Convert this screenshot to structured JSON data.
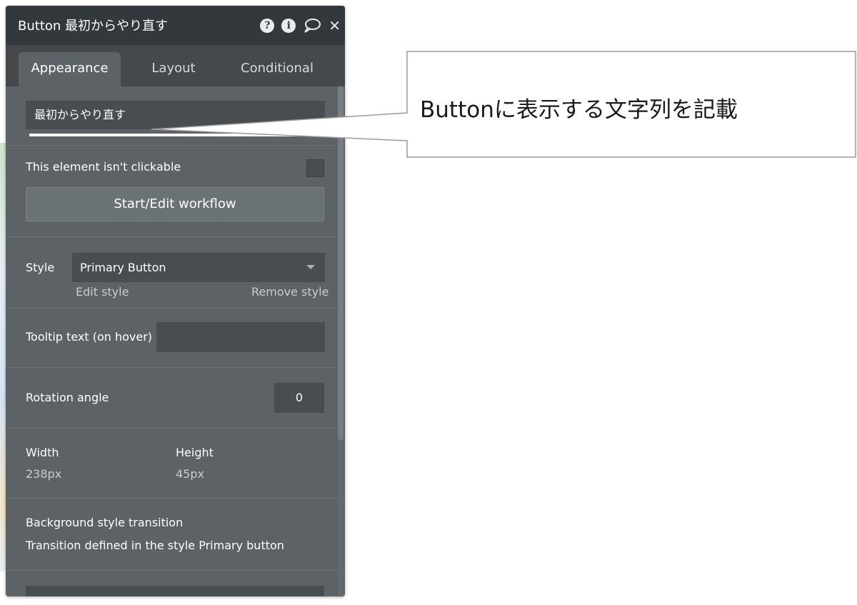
{
  "window": {
    "title": "Button 最初からやり直す",
    "icons": [
      "help-icon",
      "info-icon",
      "comment-icon",
      "close-icon"
    ],
    "icon_glyphs": {
      "help": "?",
      "info": "i",
      "close": "✕"
    }
  },
  "tabs": [
    {
      "label": "Appearance",
      "active": true
    },
    {
      "label": "Layout",
      "active": false
    },
    {
      "label": "Conditional",
      "active": false
    }
  ],
  "appearance": {
    "button_text_value": "最初からやり直す",
    "not_clickable_label": "This element isn't clickable",
    "not_clickable_checked": false,
    "workflow_button_label": "Start/Edit workflow",
    "style_label": "Style",
    "style_value": "Primary Button",
    "edit_style_label": "Edit style",
    "remove_style_label": "Remove style",
    "tooltip_label": "Tooltip text (on hover)",
    "tooltip_value": "",
    "rotation_label": "Rotation angle",
    "rotation_value": "0",
    "width_label": "Width",
    "width_value": "238px",
    "height_label": "Height",
    "height_value": "45px",
    "bg_transition_label": "Background style transition",
    "bg_transition_text": "Transition defined in the style Primary button"
  },
  "annotation": {
    "text": "Buttonに表示する文字列を記載"
  },
  "colors": {
    "titlebar": "#32383b",
    "panel": "#5c6266",
    "tabbar": "#45494c",
    "field": "#484d50"
  }
}
